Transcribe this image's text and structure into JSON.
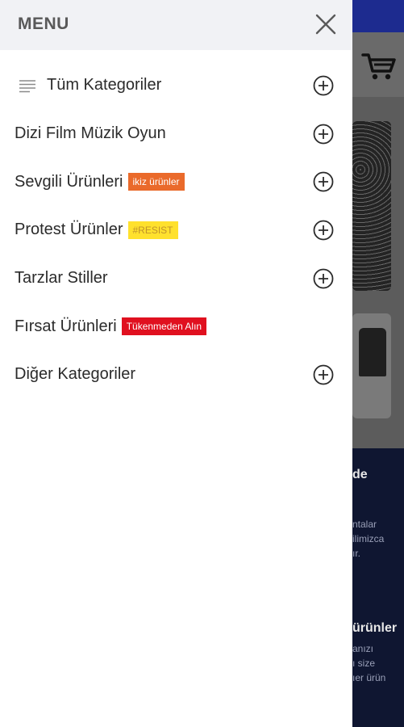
{
  "drawer": {
    "title": "MENU",
    "close_icon": "close-icon",
    "items": [
      {
        "label": "Tüm Kategoriler",
        "icon": "list-icon",
        "has_expand": true
      },
      {
        "label": "Dizi Film Müzik Oyun",
        "has_expand": true
      },
      {
        "label": "Sevgili Ürünleri",
        "badge": "ikiz ürünler",
        "badge_color": "#ea6a2b",
        "has_expand": true
      },
      {
        "label": "Protest Ürünler",
        "badge": "#RESIST",
        "badge_color": "#ffe12d",
        "has_expand": true
      },
      {
        "label": "Tarzlar Stiller",
        "has_expand": true
      },
      {
        "label": "Fırsat Ürünleri",
        "badge": "Tükenmeden Alın",
        "badge_color": "#e0101f",
        "has_expand": false
      },
      {
        "label": "Diğer Kategoriler",
        "has_expand": true
      }
    ]
  },
  "background": {
    "section_title_1": "de",
    "section_text_1": [
      "ntalar",
      "ilimizca",
      "ır."
    ],
    "section_title_2": "ürünler",
    "section_text_2": [
      "anızı",
      "ı size",
      "ıer ürün"
    ]
  },
  "colors": {
    "topbar": "#1d2b8f",
    "dark_section": "#0f1631",
    "drawer_header": "#f1f2f5"
  }
}
